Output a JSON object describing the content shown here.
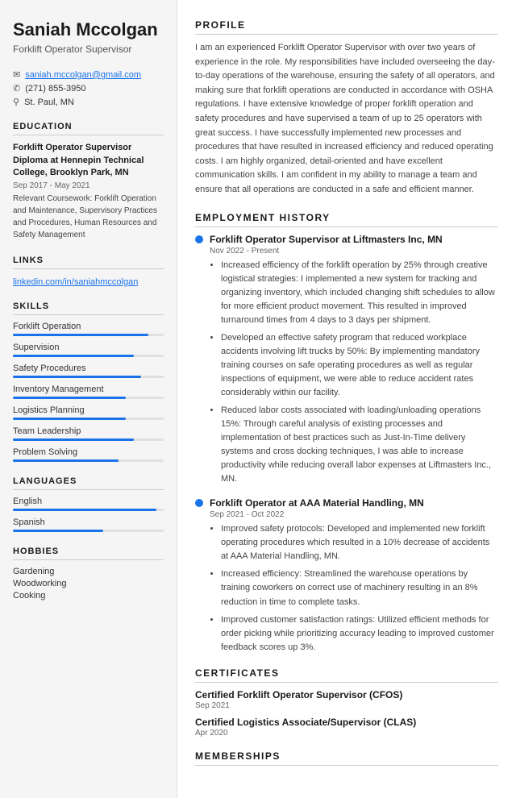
{
  "sidebar": {
    "name": "Saniah Mccolgan",
    "jobTitle": "Forklift Operator Supervisor",
    "contact": {
      "email": "saniah.mccolgan@gmail.com",
      "phone": "(271) 855-3950",
      "location": "St. Paul, MN"
    },
    "education": {
      "degree": "Forklift Operator Supervisor Diploma at Hennepin Technical College, Brooklyn Park, MN",
      "dates": "Sep 2017 - May 2021",
      "coursework": "Relevant Coursework: Forklift Operation and Maintenance, Supervisory Practices and Procedures, Human Resources and Safety Management"
    },
    "links": [
      {
        "text": "linkedin.com/in/saniahmccolgan",
        "url": "#"
      }
    ],
    "skills": [
      {
        "name": "Forklift Operation",
        "pct": 90
      },
      {
        "name": "Supervision",
        "pct": 80
      },
      {
        "name": "Safety Procedures",
        "pct": 85
      },
      {
        "name": "Inventory Management",
        "pct": 75
      },
      {
        "name": "Logistics Planning",
        "pct": 75
      },
      {
        "name": "Team Leadership",
        "pct": 80
      },
      {
        "name": "Problem Solving",
        "pct": 70
      }
    ],
    "languages": [
      {
        "name": "English",
        "pct": 95
      },
      {
        "name": "Spanish",
        "pct": 60
      }
    ],
    "hobbies": [
      "Gardening",
      "Woodworking",
      "Cooking"
    ],
    "sectionTitles": {
      "education": "Education",
      "links": "Links",
      "skills": "Skills",
      "languages": "Languages",
      "hobbies": "Hobbies"
    }
  },
  "main": {
    "sections": {
      "profile": "Profile",
      "employment": "Employment History",
      "certificates": "Certificates",
      "memberships": "Memberships"
    },
    "profile": "I am an experienced Forklift Operator Supervisor with over two years of experience in the role. My responsibilities have included overseeing the day-to-day operations of the warehouse, ensuring the safety of all operators, and making sure that forklift operations are conducted in accordance with OSHA regulations. I have extensive knowledge of proper forklift operation and safety procedures and have supervised a team of up to 25 operators with great success. I have successfully implemented new processes and procedures that have resulted in increased efficiency and reduced operating costs. I am highly organized, detail-oriented and have excellent communication skills. I am confident in my ability to manage a team and ensure that all operations are conducted in a safe and efficient manner.",
    "employment": [
      {
        "title": "Forklift Operator Supervisor at Liftmasters Inc, MN",
        "dates": "Nov 2022 - Present",
        "bullets": [
          "Increased efficiency of the forklift operation by 25% through creative logistical strategies: I implemented a new system for tracking and organizing inventory, which included changing shift schedules to allow for more efficient product movement. This resulted in improved turnaround times from 4 days to 3 days per shipment.",
          "Developed an effective safety program that reduced workplace accidents involving lift trucks by 50%: By implementing mandatory training courses on safe operating procedures as well as regular inspections of equipment, we were able to reduce accident rates considerably within our facility.",
          "Reduced labor costs associated with loading/unloading operations 15%: Through careful analysis of existing processes and implementation of best practices such as Just-In-Time delivery systems and cross docking techniques, I was able to increase productivity while reducing overall labor expenses at Liftmasters Inc., MN."
        ]
      },
      {
        "title": "Forklift Operator at AAA Material Handling, MN",
        "dates": "Sep 2021 - Oct 2022",
        "bullets": [
          "Improved safety protocols: Developed and implemented new forklift operating procedures which resulted in a 10% decrease of accidents at AAA Material Handling, MN.",
          "Increased efficiency: Streamlined the warehouse operations by training coworkers on correct use of machinery resulting in an 8% reduction in time to complete tasks.",
          "Improved customer satisfaction ratings: Utilized efficient methods for order picking while prioritizing accuracy leading to improved customer feedback scores up 3%."
        ]
      }
    ],
    "certificates": [
      {
        "name": "Certified Forklift Operator Supervisor (CFOS)",
        "date": "Sep 2021"
      },
      {
        "name": "Certified Logistics Associate/Supervisor (CLAS)",
        "date": "Apr 2020"
      }
    ]
  }
}
